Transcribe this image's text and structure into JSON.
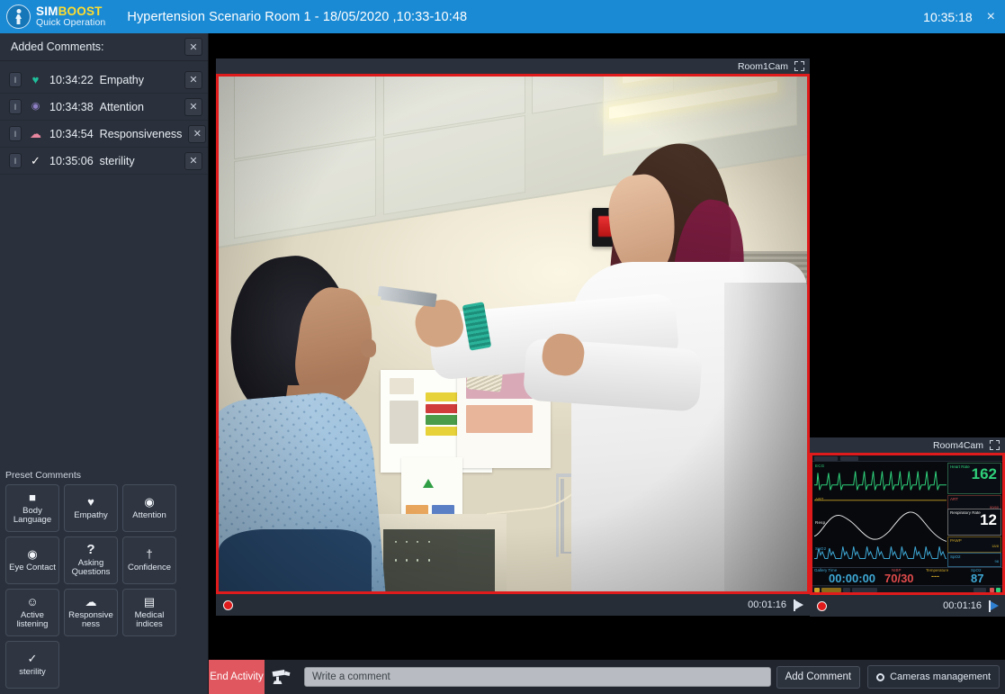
{
  "titlebar": {
    "logo_sim": "SIM",
    "logo_boost": "BOOST",
    "logo_sub": "Quick Operation",
    "title": "Hypertension Scenario Room 1 - 18/05/2020 ,10:33-10:48",
    "clock": "10:35:18",
    "close_label": "×"
  },
  "sidebar": {
    "header_title": "Added Comments:",
    "header_close": "✕",
    "row_close": "✕",
    "pill_label": "I",
    "comments": [
      {
        "icon": "heart-icon",
        "glyph": "♥",
        "color": "#1fbf9c",
        "time": "10:34:22",
        "label": "Empathy"
      },
      {
        "icon": "eye-icon",
        "glyph": "◉",
        "color": "#8e7fc4",
        "time": "10:34:38",
        "label": "Attention"
      },
      {
        "icon": "speech-bubble-icon",
        "glyph": "☁",
        "color": "#e8879f",
        "time": "10:34:54",
        "label": "Responsiveness"
      },
      {
        "icon": "check-icon",
        "glyph": "✓",
        "color": "#ffffff",
        "time": "10:35:06",
        "label": "sterility"
      }
    ],
    "preset_title": "Preset Comments",
    "presets": [
      {
        "icon": "square-icon",
        "glyph": "■",
        "label": "Body\nLanguage"
      },
      {
        "icon": "heart-icon",
        "glyph": "♥",
        "label": "Empathy"
      },
      {
        "icon": "eye-icon",
        "glyph": "◉",
        "label": "Attention"
      },
      {
        "icon": "eye-icon",
        "glyph": "◉",
        "label": "Eye Contact"
      },
      {
        "icon": "question-mark-icon",
        "glyph": "?",
        "label": "Asking\nQuestions"
      },
      {
        "icon": "person-icon",
        "glyph": "†",
        "label": "Confidence"
      },
      {
        "icon": "smiley-icon",
        "glyph": "☺",
        "label": "Active\nlistening"
      },
      {
        "icon": "speech-bubble-icon",
        "glyph": "☁",
        "label": "Responsive\nness"
      },
      {
        "icon": "monitor-icon",
        "glyph": "▤",
        "label": "Medical\nindices"
      },
      {
        "icon": "check-icon",
        "glyph": "✓",
        "label": "sterility"
      }
    ]
  },
  "cameras": {
    "main": {
      "title": "Room1Cam",
      "timecode": "00:01:16"
    },
    "secondary": {
      "title": "Room4Cam",
      "timecode": "00:01:16"
    }
  },
  "monitor": {
    "heart_rate_label": "Heart Rate",
    "heart_rate": "162",
    "resp_rate_label": "Respiratory Rate",
    "resp_rate": "12",
    "spo2_label": "SpO2",
    "spo2": "87",
    "gallery_label": "Gallery Time",
    "gallery_time": "00:00:00",
    "nibp_label": "NIBP",
    "nibp": "70/30",
    "temp_label": "Temperature",
    "temp": "---",
    "wave_ecg": "ECG",
    "wave_art": "ART",
    "wave_resp": "Resp",
    "wave_pleth": "SpO2"
  },
  "bottombar": {
    "end_activity": "End Activity",
    "camera_icon": "cctv-camera-icon",
    "comment_placeholder": "Write a comment",
    "comment_value": "",
    "add_comment": "Add Comment",
    "cameras_management": "Cameras management"
  }
}
